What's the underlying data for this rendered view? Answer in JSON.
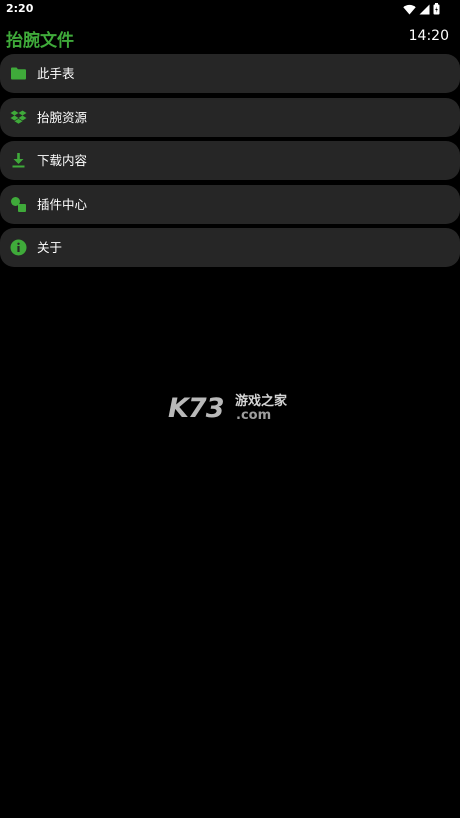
{
  "status_bar": {
    "time": "2:20",
    "icons": [
      "wifi-icon",
      "signal-icon",
      "battery-icon"
    ]
  },
  "header": {
    "title": "抬腕文件",
    "clock": "14:20"
  },
  "menu": {
    "items": [
      {
        "label": "此手表",
        "icon": "folder-icon"
      },
      {
        "label": "抬腕资源",
        "icon": "dropbox-icon"
      },
      {
        "label": "下载内容",
        "icon": "download-icon"
      },
      {
        "label": "插件中心",
        "icon": "plugin-icon"
      },
      {
        "label": "关于",
        "icon": "info-icon"
      }
    ]
  },
  "watermark": {
    "brand": "K73",
    "name": "游戏之家",
    "domain": ".com"
  },
  "colors": {
    "accent": "#3faa3a",
    "background": "#000000",
    "item_background": "#262626",
    "text": "#ffffff"
  }
}
